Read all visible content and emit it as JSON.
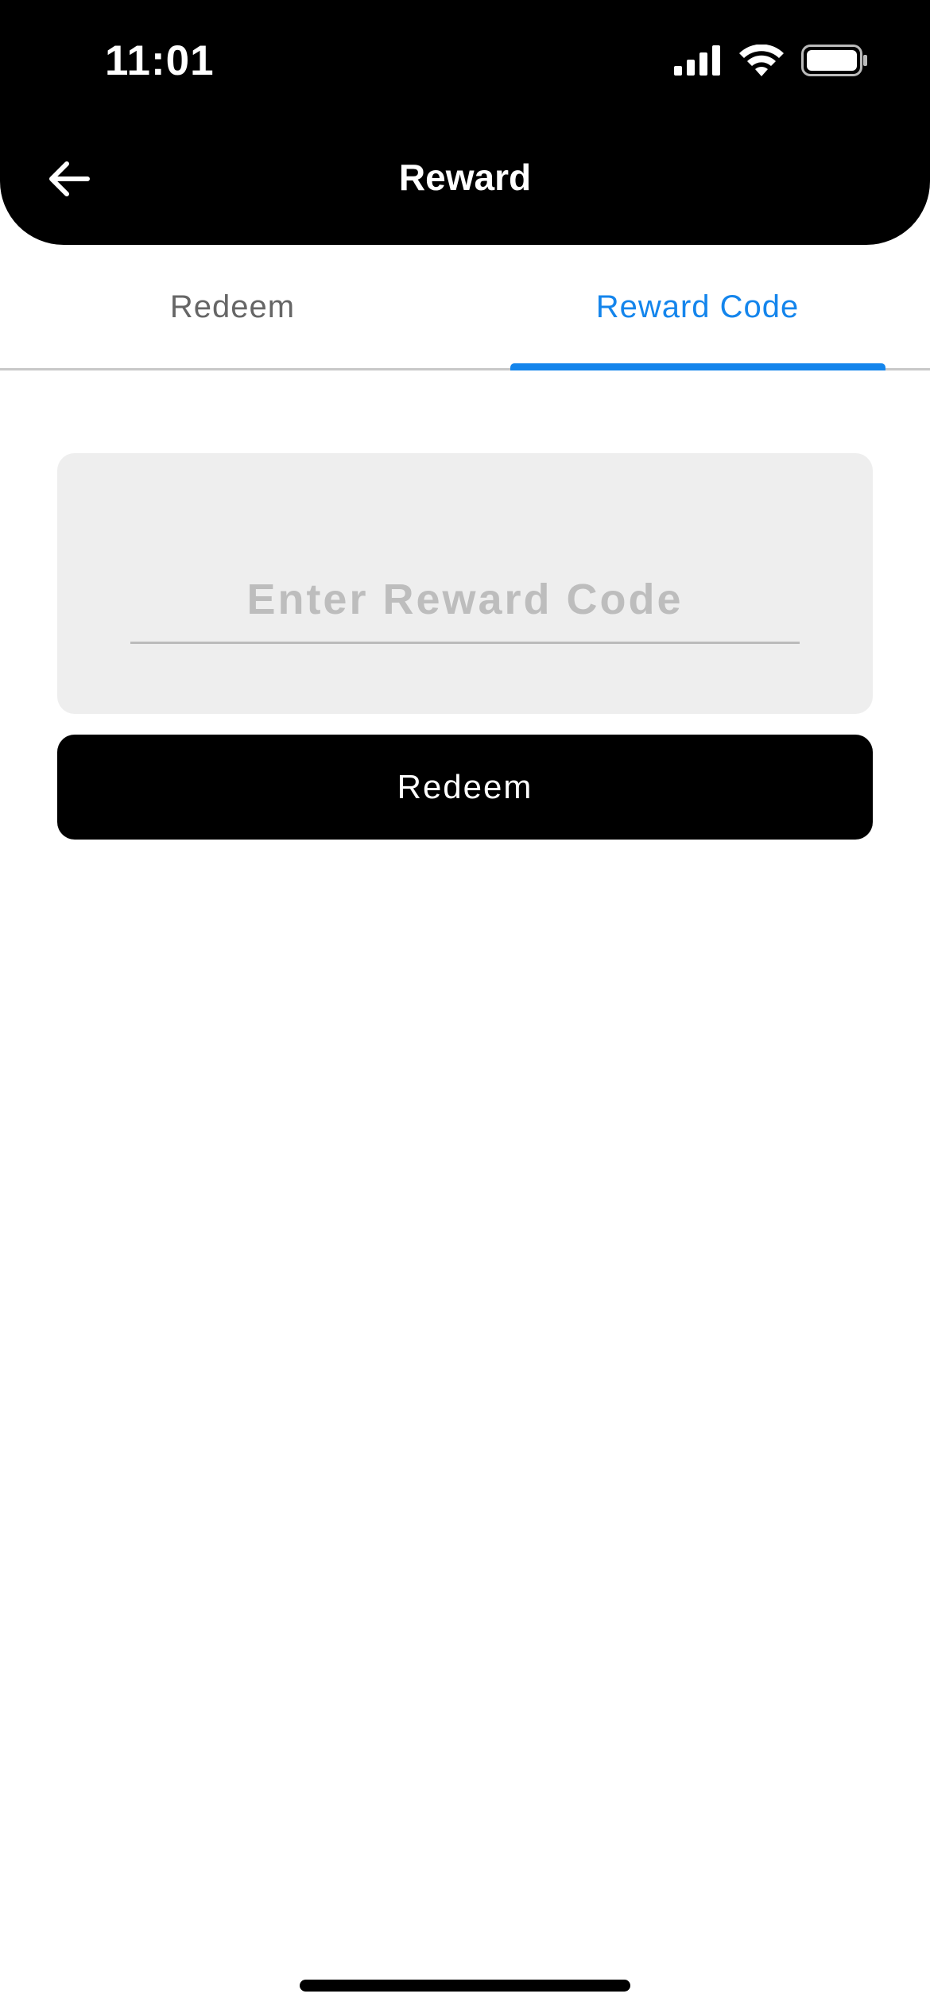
{
  "status_bar": {
    "time": "11:01",
    "icons": [
      "signal-icon",
      "wifi-icon",
      "battery-icon"
    ]
  },
  "header": {
    "back_icon": "arrow-left-icon",
    "title": "Reward"
  },
  "tabs": [
    {
      "label": "Redeem",
      "active": false
    },
    {
      "label": "Reward Code",
      "active": true
    }
  ],
  "reward_code_form": {
    "input_value": "",
    "input_placeholder": "Enter Reward Code",
    "submit_label": "Redeem"
  },
  "colors": {
    "header_bg": "#000000",
    "accent": "#1485ec",
    "tab_inactive": "#666666",
    "card_bg": "#eeeeee",
    "placeholder": "#bdbdbd",
    "button_bg": "#000000"
  }
}
